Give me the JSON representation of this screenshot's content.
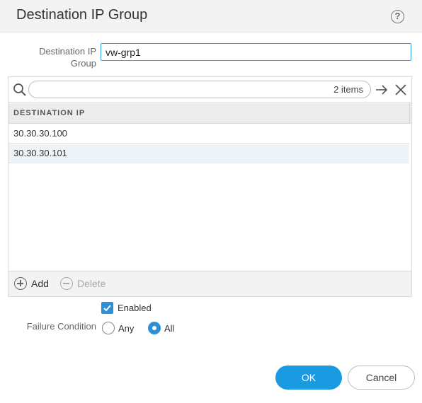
{
  "dialog": {
    "title": "Destination IP Group",
    "help_icon": "question-circle-icon",
    "help_glyph": "?"
  },
  "form": {
    "name_label": "Destination IP Group",
    "name_value": "vw-grp1"
  },
  "search": {
    "items_count": "2 items",
    "icons": [
      "search-icon",
      "arrow-right-icon",
      "close-icon"
    ]
  },
  "table": {
    "column_header": "DESTINATION IP",
    "rows": [
      "30.30.30.100",
      "30.30.30.101"
    ]
  },
  "toolbar": {
    "add_label": "Add",
    "delete_label": "Delete",
    "add_icon": "plus-circle-icon",
    "delete_icon": "minus-circle-icon"
  },
  "options": {
    "enabled_label": "Enabled",
    "enabled_checked": true,
    "failure_condition_label": "Failure Condition",
    "any_label": "Any",
    "all_label": "All",
    "selected_condition": "All"
  },
  "buttons": {
    "ok_label": "OK",
    "cancel_label": "Cancel"
  },
  "colors": {
    "accent": "#1a9ae0",
    "row_highlight": "#eef3f7"
  }
}
